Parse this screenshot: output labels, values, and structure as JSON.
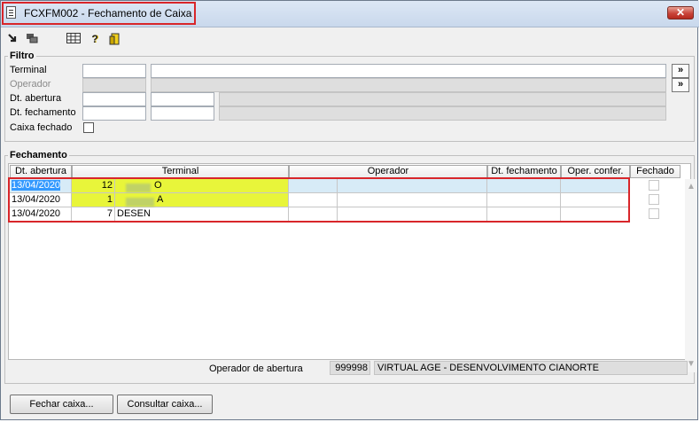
{
  "window": {
    "title": "FCXFM002 - Fechamento de Caixa",
    "close_symbol": "✕"
  },
  "toolbar": {
    "icons": [
      "export-icon",
      "copy-icon",
      "grid-icon",
      "help-icon",
      "exit-icon"
    ],
    "help_glyph": "?"
  },
  "filtro": {
    "group_label": "Filtro",
    "terminal_label": "Terminal",
    "operador_label": "Operador",
    "dt_abertura_label": "Dt. abertura",
    "dt_fechamento_label": "Dt. fechamento",
    "caixa_fechado_label": "Caixa fechado",
    "search_button_label": "»"
  },
  "fechamento": {
    "group_label": "Fechamento",
    "columns": [
      "Dt. abertura",
      "Terminal",
      "Operador",
      "Dt. fechamento",
      "Oper. confer.",
      "Fechado"
    ],
    "rows": [
      {
        "dt_abertura": "13/04/2020",
        "terminal_code": "12",
        "terminal_name": "O",
        "operador": "",
        "dt_fechamento": "",
        "oper_confer": ""
      },
      {
        "dt_abertura": "13/04/2020",
        "terminal_code": "1",
        "terminal_name": "A",
        "operador": "",
        "dt_fechamento": "",
        "oper_confer": ""
      },
      {
        "dt_abertura": "13/04/2020",
        "terminal_code": "7",
        "terminal_name": "DESEN",
        "operador": "",
        "dt_fechamento": "",
        "oper_confer": ""
      }
    ],
    "operador_abertura_label": "Operador de abertura",
    "operador_abertura_code": "999998",
    "operador_abertura_name": "VIRTUAL AGE - DESENVOLVIMENTO CIANORTE"
  },
  "buttons": {
    "fechar": "Fechar caixa...",
    "consultar": "Consultar caixa..."
  },
  "colors": {
    "selection": "#d7ebf7",
    "highlight": "#e8f53a",
    "annotation": "#d8262a"
  }
}
